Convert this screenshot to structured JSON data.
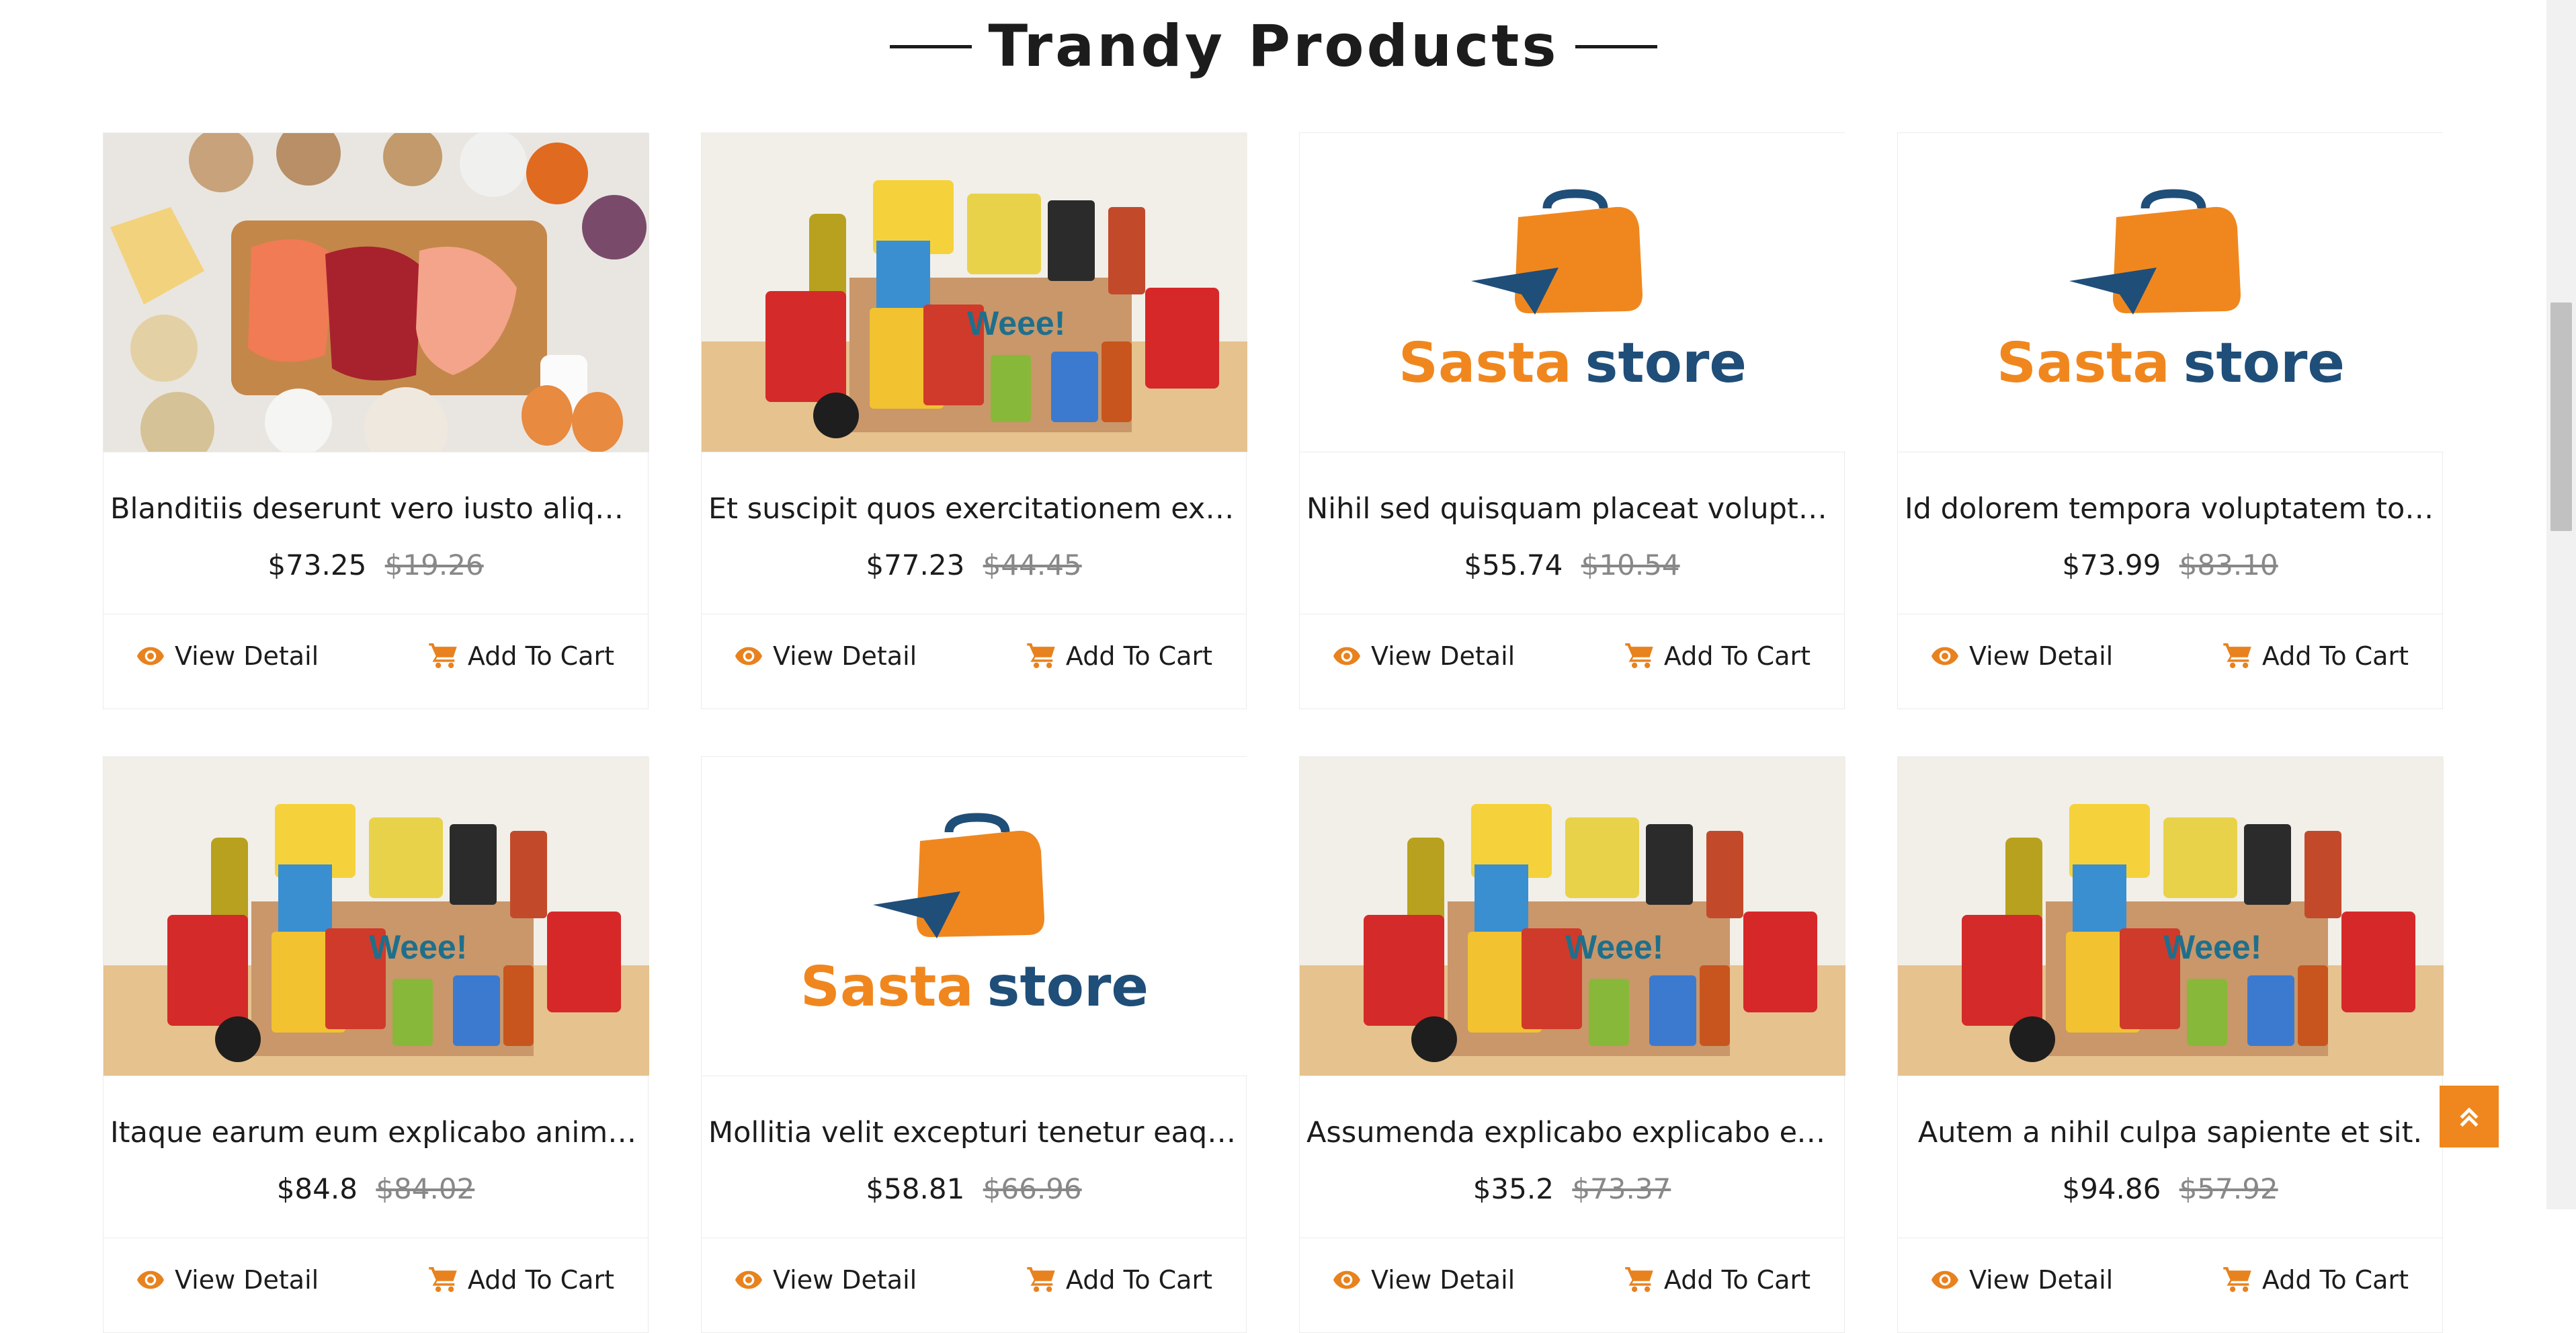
{
  "section": {
    "title": "Trandy Products"
  },
  "actions": {
    "view_label": "View Detail",
    "cart_label": "Add To Cart"
  },
  "products": [
    {
      "name": "Blanditiis deserunt vero iusto aliquam …",
      "price": "$73.25",
      "old_price": "$19.26",
      "image": "raw-foods-photo"
    },
    {
      "name": "Et suscipit quos exercitationem ex volu…",
      "price": "$77.23",
      "old_price": "$44.45",
      "image": "grocery-box-photo"
    },
    {
      "name": "Nihil sed quisquam placeat voluptates…",
      "price": "$55.74",
      "old_price": "$10.54",
      "image": "sasta-store-logo"
    },
    {
      "name": "Id dolorem tempora voluptatem tota…",
      "price": "$73.99",
      "old_price": "$83.10",
      "image": "sasta-store-logo"
    },
    {
      "name": "Itaque earum eum explicabo animi as…",
      "price": "$84.8",
      "old_price": "$84.02",
      "image": "grocery-box-photo"
    },
    {
      "name": "Mollitia velit excepturi tenetur eaque.",
      "price": "$58.81",
      "old_price": "$66.96",
      "image": "sasta-store-logo"
    },
    {
      "name": "Assumenda explicabo explicabo explic…",
      "price": "$35.2",
      "old_price": "$73.37",
      "image": "grocery-box-photo"
    },
    {
      "name": "Autem a nihil culpa sapiente et sit.",
      "price": "$94.86",
      "old_price": "$57.92",
      "image": "grocery-box-photo"
    }
  ],
  "logo": {
    "word1": "Sasta",
    "word2": "store"
  },
  "colors": {
    "accent": "#f0871e",
    "logo_blue": "#1f4e79"
  },
  "icons": {
    "view": "eye-icon",
    "cart": "cart-icon",
    "back_to_top": "double-chevron-up-icon"
  }
}
